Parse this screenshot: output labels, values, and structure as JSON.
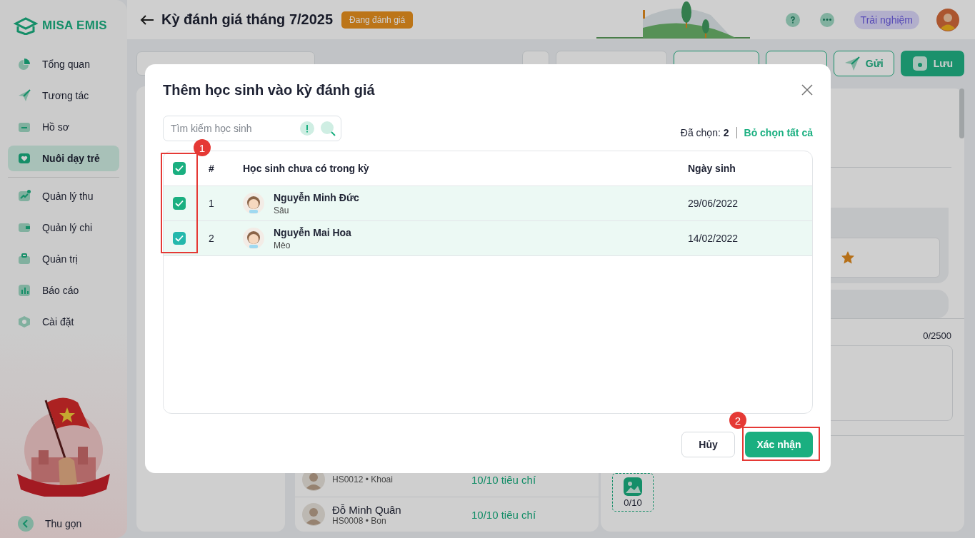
{
  "app": {
    "logo": "MISA EMIS"
  },
  "sidebar": {
    "items": [
      {
        "label": "Tổng quan",
        "selected": false,
        "notify": false
      },
      {
        "label": "Tương tác",
        "selected": false,
        "notify": false
      },
      {
        "label": "Hồ sơ",
        "selected": false,
        "notify": false
      },
      {
        "label": "Nuôi dạy trẻ",
        "selected": true,
        "notify": false
      },
      {
        "label": "Quản lý thu",
        "selected": false,
        "notify": true
      },
      {
        "label": "Quản lý chi",
        "selected": false,
        "notify": false
      },
      {
        "label": "Quản trị",
        "selected": false,
        "notify": false
      },
      {
        "label": "Báo cáo",
        "selected": false,
        "notify": false
      },
      {
        "label": "Cài đặt",
        "selected": false,
        "notify": false
      }
    ],
    "collapse": "Thu gọn"
  },
  "header": {
    "title": "Kỳ đánh giá tháng 7/2025",
    "status": "Đang đánh giá",
    "trial": "Trải nghiệm"
  },
  "toolbar": {
    "buttons": [
      {
        "kind": "plain"
      },
      {
        "kind": "outline"
      },
      {
        "kind": "outline"
      },
      {
        "label": "Gửi",
        "kind": "outline"
      },
      {
        "label": "Lưu",
        "kind": "primary"
      }
    ]
  },
  "student_list": [
    {
      "code": "HS0012 • Khoai",
      "progress": "10/10 tiêu chí",
      "complete": true
    },
    {
      "name": "Đỗ Minh Quân",
      "code": "HS0008 • Bon",
      "progress": "10/10 tiêu chí",
      "complete": true
    }
  ],
  "detail": {
    "char_count": "0/2500",
    "photo_count": "0/10"
  },
  "dialog": {
    "title": "Thêm học sinh vào kỳ đánh giá",
    "search_placeholder": "Tìm kiếm học sinh",
    "selected_label": "Đã chọn:",
    "selected_count": "2",
    "clear_all": "Bỏ chọn tất cả",
    "columns": [
      "#",
      "Học sinh chưa có trong kỳ",
      "Ngày sinh"
    ],
    "all_checked": true,
    "rows": [
      {
        "checked": true,
        "index": "1",
        "name": "Nguyễn Minh Đức",
        "nickname": "Sâu",
        "birthdate": "29/06/2022"
      },
      {
        "checked": true,
        "index": "2",
        "name": "Nguyễn Mai Hoa",
        "nickname": "Mèo",
        "birthdate": "14/02/2022"
      }
    ],
    "cancel": "Hủy",
    "confirm": "Xác nhận"
  },
  "annotations": [
    {
      "label": "1"
    },
    {
      "label": "2"
    }
  ]
}
